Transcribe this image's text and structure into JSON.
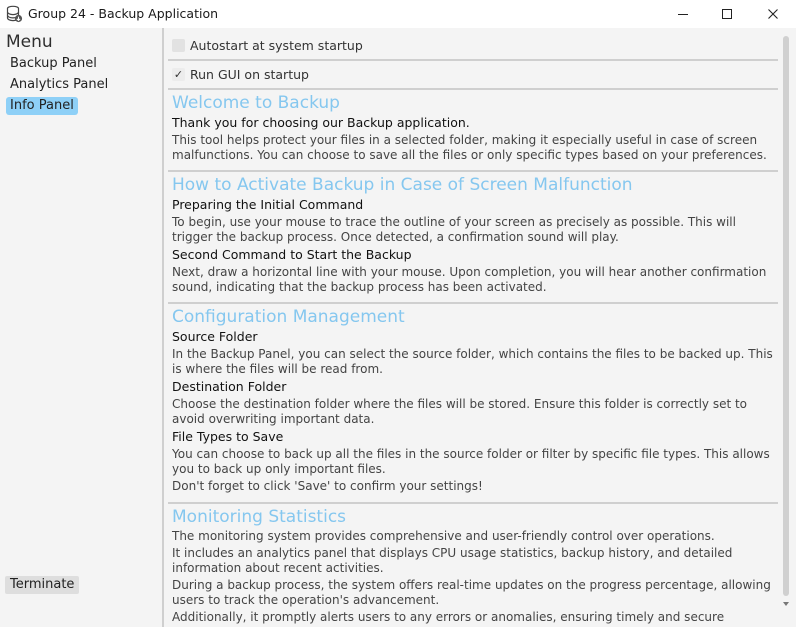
{
  "window": {
    "title": "Group 24 - Backup Application"
  },
  "sidebar": {
    "menu_title": "Menu",
    "items": [
      {
        "label": "Backup Panel",
        "active": false
      },
      {
        "label": "Analytics Panel",
        "active": false
      },
      {
        "label": "Info Panel",
        "active": true
      }
    ],
    "terminate_label": "Terminate"
  },
  "options": {
    "autostart": {
      "label": "Autostart at system startup",
      "checked": false
    },
    "run_gui": {
      "label": "Run GUI on startup",
      "checked": true
    }
  },
  "info": {
    "welcome": {
      "heading": "Welcome to Backup",
      "subtitle": "Thank you for choosing our Backup application.",
      "text": "This tool helps protect your files in a selected folder, making it especially useful in case of screen malfunctions. You can choose to save all the files or only specific types based on your preferences."
    },
    "activate": {
      "heading": "How to Activate Backup in Case of Screen Malfunction",
      "sub1": "Preparing the Initial Command",
      "text1": "To begin, use your mouse to trace the outline of your screen as precisely as possible. This will trigger the backup process. Once detected, a confirmation sound will play.",
      "sub2": "Second Command to Start the Backup",
      "text2": "Next, draw a horizontal line with your mouse. Upon completion, you will hear another confirmation sound, indicating that the backup process has been activated."
    },
    "config": {
      "heading": "Configuration Management",
      "sub1": "Source Folder",
      "text1": "In the Backup Panel, you can select the source folder, which contains the files to be backed up. This is where the files will be read from.",
      "sub2": "Destination Folder",
      "text2": "Choose the destination folder where the files will be stored. Ensure this folder is correctly set to avoid overwriting important data.",
      "sub3": "File Types to Save",
      "text3": "You can choose to back up all the files in the source folder or filter by specific file types. This allows you to back up only important files.",
      "text4": "Don't forget to click 'Save' to confirm your settings!"
    },
    "monitoring": {
      "heading": "Monitoring Statistics",
      "text1": "The monitoring system provides comprehensive and user-friendly control over operations.",
      "text2": "It includes an analytics panel that displays CPU usage statistics, backup history, and detailed information about recent activities.",
      "text3": "During a backup process, the system offers real-time updates on the progress percentage, allowing users to track the operation's advancement.",
      "text4": "Additionally, it promptly alerts users to any errors or anomalies, ensuring timely and secure management"
    }
  },
  "colors": {
    "heading": "#85c7ef",
    "active_item": "#8ed0f7"
  },
  "icons": {
    "app": "database-stack-icon",
    "minimize": "minimize-icon",
    "maximize": "maximize-icon",
    "close": "close-icon"
  }
}
